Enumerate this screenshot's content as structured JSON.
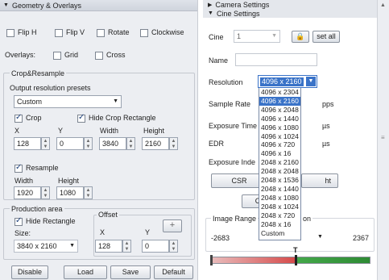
{
  "left": {
    "geometry_title": "Geometry & Overlays",
    "flip_h": "Flip H",
    "flip_v": "Flip V",
    "rotate": "Rotate",
    "clockwise": "Clockwise",
    "overlays_label": "Overlays:",
    "grid": "Grid",
    "cross": "Cross",
    "crop_resample_title": "Crop&Resample",
    "output_presets_label": "Output resolution presets",
    "preset_value": "Custom",
    "crop": "Crop",
    "hide_crop_rect": "Hide Crop Rectangle",
    "x_label": "X",
    "y_label": "Y",
    "width_label": "Width",
    "height_label": "Height",
    "crop_x": "128",
    "crop_y": "0",
    "crop_width": "3840",
    "crop_height": "2160",
    "resample": "Resample",
    "res_width_label": "Width",
    "res_height_label": "Height",
    "res_width": "1920",
    "res_height": "1080",
    "production_area_title": "Production area",
    "hide_rectangle": "Hide Rectangle",
    "offset_label": "Offset",
    "size_label": "Size:",
    "size_value": "3840 x 2160",
    "off_x_label": "X",
    "off_y_label": "Y",
    "off_x": "128",
    "off_y": "0",
    "plus_glyph": "+",
    "buttons": {
      "disable": "Disable",
      "load": "Load",
      "save": "Save",
      "default": "Default"
    }
  },
  "right": {
    "camera_settings": "Camera Settings",
    "cine_settings": "Cine Settings",
    "cine_label": "Cine",
    "cine_value": "1",
    "set_all": "set all",
    "name_label": "Name",
    "resolution_label": "Resolution",
    "resolution_value": "4096 x 2160",
    "sample_rate_label": "Sample Rate",
    "sample_rate_unit": "pps",
    "exposure_time_label": "Exposure Time",
    "exposure_unit": "µs",
    "edr_label": "EDR",
    "edr_unit": "µs",
    "exposure_index_label": "Exposure Inde",
    "csr_button": "CSR",
    "right_button_fragment": "ht",
    "c_button_fragment": "C",
    "image_range_label": "Image Range",
    "image_range_suffix": "on",
    "range_start": "-2683",
    "range_end": "2367",
    "marker": "T",
    "resolution_options": [
      "4096 x 2304",
      "4096 x 2160",
      "4096 x 2048",
      "4096 x 1440",
      "4096 x 1080",
      "4096 x 1024",
      "4096 x 720",
      "4096 x 16",
      "2048 x 2160",
      "2048 x 2048",
      "2048 x 1536",
      "2048 x 1440",
      "2048 x 1080",
      "2048 x 1024",
      "2048 x 720",
      "2048 x 16",
      "Custom"
    ],
    "selected_index": 1
  }
}
